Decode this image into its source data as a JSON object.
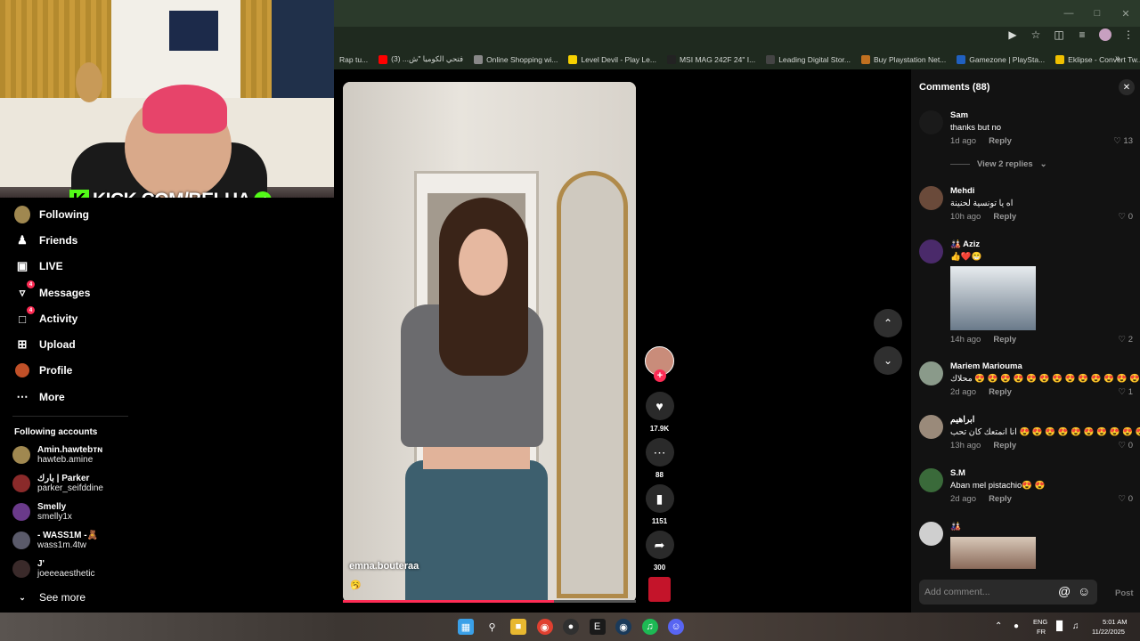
{
  "bookmarks": [
    {
      "label": "Rap tu...",
      "color": "#444"
    },
    {
      "label": "فتحي الكوميا \"ش... (3)",
      "color": "#ff0000"
    },
    {
      "label": "Online Shopping wi...",
      "color": "#888"
    },
    {
      "label": "Level Devil - Play Le...",
      "color": "#f5d000"
    },
    {
      "label": "MSI MAG 242F 24\" I...",
      "color": "#222"
    },
    {
      "label": "Leading Digital Stor...",
      "color": "#444"
    },
    {
      "label": "Buy Playstation Net...",
      "color": "#c07020"
    },
    {
      "label": "Gamezone | PlaySta...",
      "color": "#2060c0"
    },
    {
      "label": "Eklipse - Convert Tw...",
      "color": "#f0c000"
    }
  ],
  "toolbar_icons": [
    "cast-icon",
    "star-icon",
    "extensions-icon",
    "media-icon",
    "profile-icon",
    "menu-icon"
  ],
  "stream": {
    "banner_text": "KICK.COM/BELHA",
    "live_tag": "LIVE"
  },
  "sidebar": {
    "nav": [
      {
        "label": "Following",
        "icon": "following-avatar"
      },
      {
        "label": "Friends",
        "icon": "friends-icon"
      },
      {
        "label": "LIVE",
        "icon": "live-icon"
      },
      {
        "label": "Messages",
        "icon": "messages-icon",
        "badge": "4"
      },
      {
        "label": "Activity",
        "icon": "activity-icon",
        "badge": "4"
      },
      {
        "label": "Upload",
        "icon": "upload-icon"
      },
      {
        "label": "Profile",
        "icon": "profile-avatar"
      },
      {
        "label": "More",
        "icon": "more-icon"
      }
    ],
    "following_heading": "Following accounts",
    "accounts": [
      {
        "name": "Amin.hawtebᴛɴ",
        "handle": "hawteb.amine",
        "color": "#a08850"
      },
      {
        "name": "بارك | Parker",
        "handle": "parker_seifddine",
        "color": "#8a2a2a"
      },
      {
        "name": "Smelly",
        "handle": "smelly1x",
        "color": "#6a3a8a"
      },
      {
        "name": "- WASS1M -🧸",
        "handle": "wass1m.4tw",
        "color": "#5a5a6a"
      },
      {
        "name": "J'",
        "handle": "joeeeaesthetic",
        "color": "#3a2a2a"
      }
    ],
    "see_more": "See more"
  },
  "video": {
    "username": "emna.bouteraa",
    "caption_emoji": "🥱",
    "progress": 0.72
  },
  "actions": {
    "likes": "17.9K",
    "comments": "88",
    "saves": "1151",
    "shares": "300"
  },
  "comments_panel": {
    "title": "Comments (88)",
    "view_replies": "View 2 replies",
    "reply_label": "Reply",
    "input_placeholder": "Add comment...",
    "post_label": "Post",
    "items": [
      {
        "user": "Sam",
        "text": "thanks but no",
        "time": "1d ago",
        "likes": "13",
        "color": "#1a1a1a"
      },
      {
        "user": "Mehdi",
        "text": "اه يا تونسية لحنينة",
        "time": "10h ago",
        "likes": "0",
        "color": "#6a4a3a"
      },
      {
        "user": "🎎 Aziz",
        "text": "👍❤️😁",
        "time": "14h ago",
        "likes": "2",
        "color": "#4a2a6a"
      },
      {
        "user": "Mariem Mariouma",
        "text": "محلاك 😍 😍 😍 😍 😍 😍 😍 😍 😍 😍 😍 😍 😍 😍",
        "time": "2d ago",
        "likes": "1",
        "color": "#8a9a8a"
      },
      {
        "user": "ابراهيم",
        "text": "انا انمتعك كان تحب 😍 😍 😍 😍 😍 😍 😍 😍 😍 😍",
        "time": "13h ago",
        "likes": "0",
        "color": "#9a8a7a"
      },
      {
        "user": "S.M",
        "text": "Aban mel pistachio😍 😍",
        "time": "2d ago",
        "likes": "0",
        "color": "#3a6a3a"
      },
      {
        "user": "🎎",
        "text": "",
        "time": "",
        "likes": "",
        "color": "#cfcfcf"
      }
    ]
  },
  "taskbar": {
    "icons": [
      "windows-start-icon",
      "search-icon",
      "file-explorer-icon",
      "chrome-icon",
      "obs-icon",
      "epic-games-icon",
      "steam-icon",
      "spotify-icon",
      "discord-icon"
    ],
    "lang_top": "ENG",
    "lang_bottom": "FR",
    "time": "5:01 AM",
    "date": "11/22/2025"
  }
}
